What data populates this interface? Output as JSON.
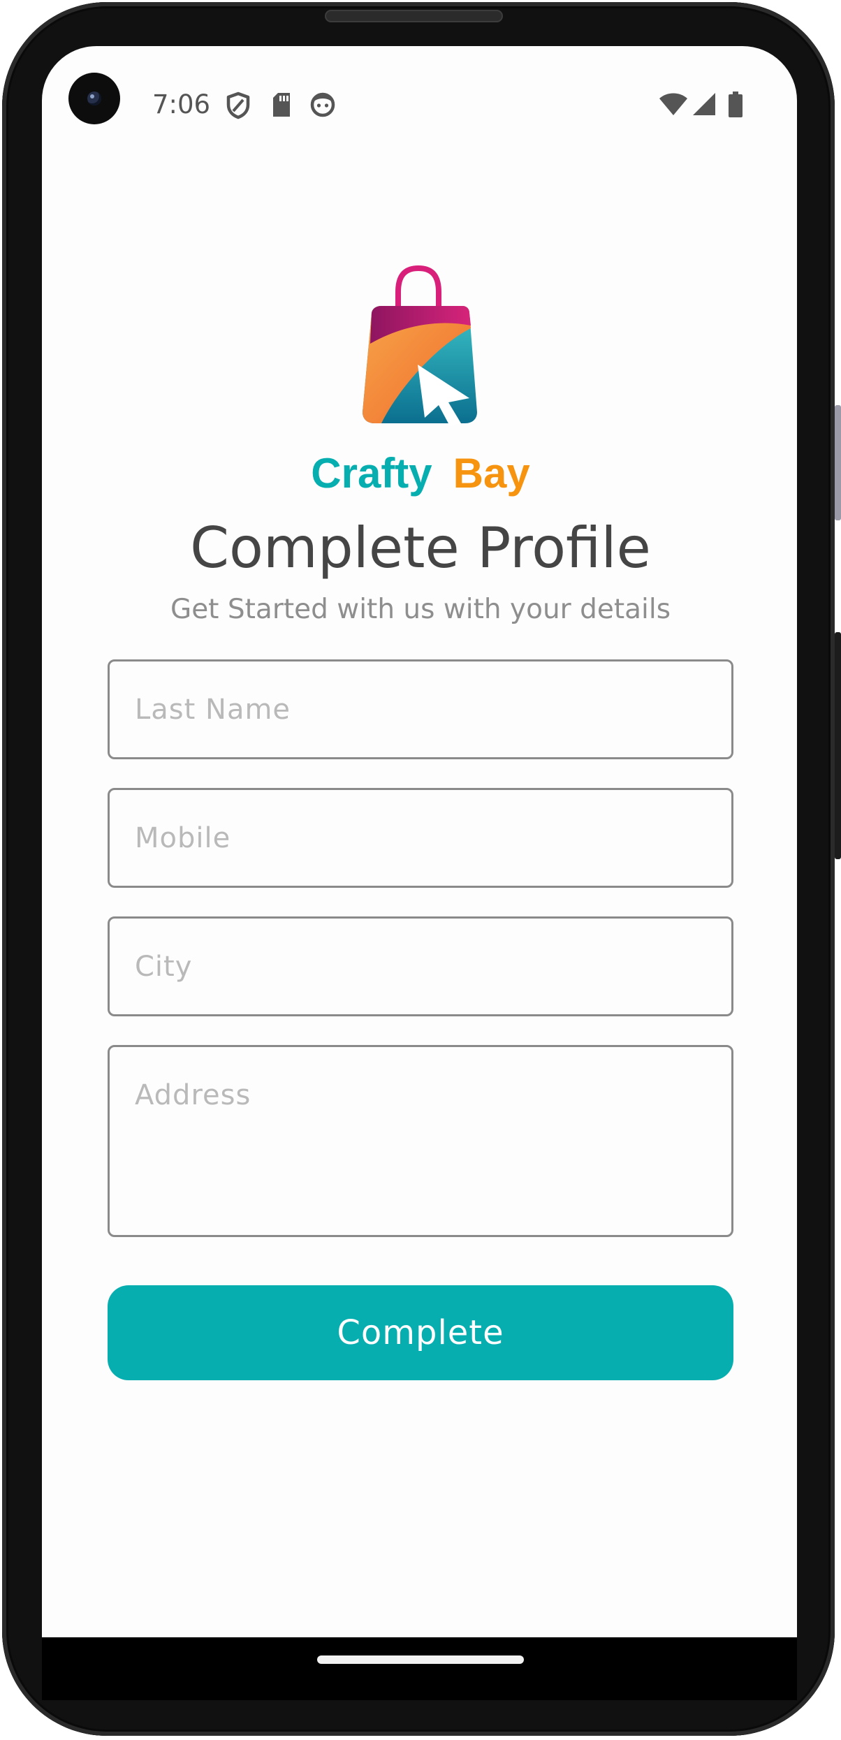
{
  "status_bar": {
    "time": "7:06",
    "left_icons": [
      "shield-icon",
      "sd-card-icon",
      "face-icon"
    ],
    "right_icons": [
      "wifi-icon",
      "cellular-signal-icon",
      "battery-icon"
    ]
  },
  "brand": {
    "word1": "Crafty",
    "word2": "Bay",
    "color1": "#07aeb0",
    "color2": "#f7940f",
    "logo_icon": "shopping-bag-cursor-icon"
  },
  "page": {
    "title": "Complete Profile",
    "subtitle": "Get Started with us with your details"
  },
  "form": {
    "last_name": {
      "placeholder": "Last Name",
      "value": ""
    },
    "mobile": {
      "placeholder": "Mobile",
      "value": ""
    },
    "city": {
      "placeholder": "City",
      "value": ""
    },
    "address": {
      "placeholder": "Address",
      "value": ""
    }
  },
  "actions": {
    "complete_label": "Complete",
    "accent_color": "#07aeb0"
  }
}
